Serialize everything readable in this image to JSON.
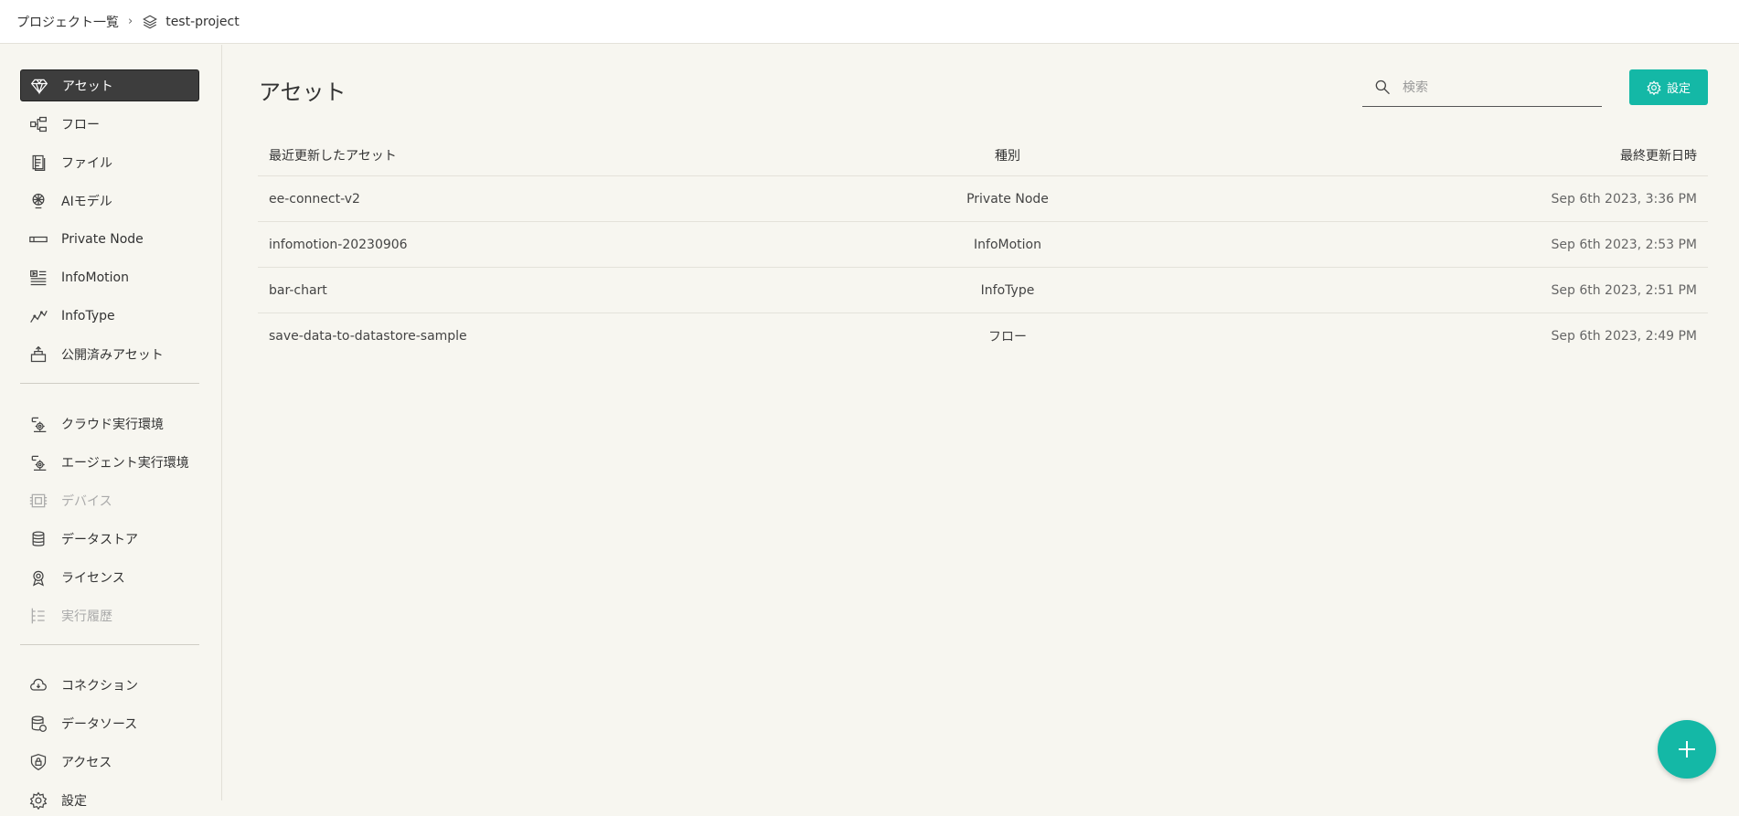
{
  "breadcrumb": {
    "root": "プロジェクト一覧",
    "separator": "›",
    "project": "test-project"
  },
  "sidebar": {
    "group1": [
      {
        "label": "アセット",
        "icon": "diamond-icon",
        "active": true
      },
      {
        "label": "フロー",
        "icon": "flow-icon"
      },
      {
        "label": "ファイル",
        "icon": "file-icon"
      },
      {
        "label": "AIモデル",
        "icon": "ai-model-icon"
      },
      {
        "label": "Private Node",
        "icon": "private-node-icon"
      },
      {
        "label": "InfoMotion",
        "icon": "infomotion-icon"
      },
      {
        "label": "InfoType",
        "icon": "infotype-icon"
      },
      {
        "label": "公開済みアセット",
        "icon": "published-asset-icon"
      }
    ],
    "group2": [
      {
        "label": "クラウド実行環境",
        "icon": "cloud-runtime-icon"
      },
      {
        "label": "エージェント実行環境",
        "icon": "agent-runtime-icon"
      },
      {
        "label": "デバイス",
        "icon": "device-icon",
        "disabled": true
      },
      {
        "label": "データストア",
        "icon": "datastore-icon"
      },
      {
        "label": "ライセンス",
        "icon": "license-icon"
      },
      {
        "label": "実行履歴",
        "icon": "history-icon",
        "disabled": true
      }
    ],
    "group3": [
      {
        "label": "コネクション",
        "icon": "connection-icon"
      },
      {
        "label": "データソース",
        "icon": "datasource-icon"
      },
      {
        "label": "アクセス",
        "icon": "access-icon"
      },
      {
        "label": "設定",
        "icon": "gear-icon"
      }
    ]
  },
  "main": {
    "title": "アセット",
    "search_placeholder": "検索",
    "settings_label": "設定",
    "table": {
      "headers": [
        "最近更新したアセット",
        "種別",
        "最終更新日時"
      ],
      "rows": [
        [
          "ee-connect-v2",
          "Private Node",
          "Sep 6th 2023, 3:36 PM"
        ],
        [
          "infomotion-20230906",
          "InfoMotion",
          "Sep 6th 2023, 2:53 PM"
        ],
        [
          "bar-chart",
          "InfoType",
          "Sep 6th 2023, 2:51 PM"
        ],
        [
          "save-data-to-datastore-sample",
          "フロー",
          "Sep 6th 2023, 2:49 PM"
        ]
      ]
    }
  },
  "colors": {
    "accent": "#14b8a6",
    "active_nav": "#3d3d3d",
    "background": "#f7f6f0"
  }
}
